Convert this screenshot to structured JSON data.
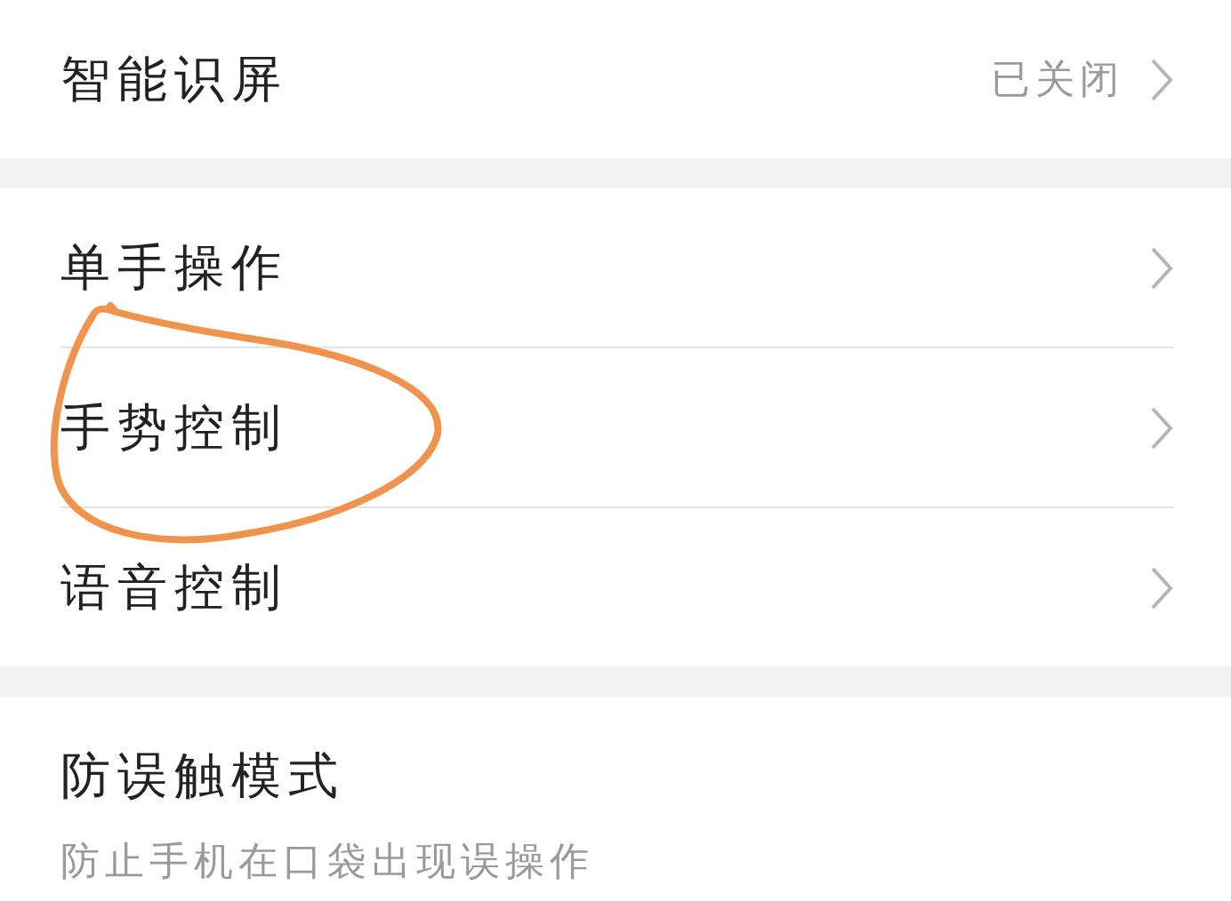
{
  "sections": [
    {
      "rows": [
        {
          "title": "智能识屏",
          "value": "已关闭",
          "arrow": true
        }
      ]
    },
    {
      "rows": [
        {
          "title": "单手操作",
          "arrow": true
        },
        {
          "title": "手势控制",
          "arrow": true
        },
        {
          "title": "语音控制",
          "arrow": true
        }
      ]
    },
    {
      "rows": [
        {
          "title": "防误触模式",
          "subtitle": "防止手机在口袋出现误操作",
          "arrow": false
        }
      ]
    }
  ]
}
